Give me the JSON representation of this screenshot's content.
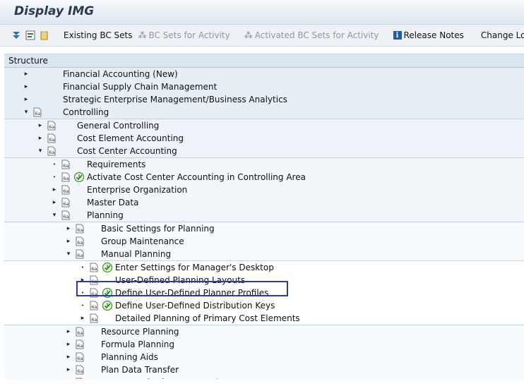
{
  "window": {
    "title": "Display IMG"
  },
  "toolbar": {
    "existing_bc_sets": "Existing BC Sets",
    "bc_sets_for_activity": "BC Sets for Activity",
    "activated_bc_sets": "Activated BC Sets for Activity",
    "release_notes": "Release Notes",
    "change_log": "Change Log"
  },
  "tree": {
    "header": "Structure",
    "rows": [
      {
        "label": "Financial Accounting (New)",
        "level": 0,
        "state": "collapsed",
        "doc": false,
        "exec": false,
        "group": 0
      },
      {
        "label": "Financial Supply Chain Management",
        "level": 0,
        "state": "collapsed",
        "doc": false,
        "exec": false,
        "group": 0
      },
      {
        "label": "Strategic Enterprise Management/Business Analytics",
        "level": 0,
        "state": "collapsed",
        "doc": false,
        "exec": false,
        "group": 0
      },
      {
        "label": "Controlling",
        "level": 0,
        "state": "expanded",
        "doc": true,
        "exec": false,
        "group": 0
      },
      {
        "label": "General Controlling",
        "level": 1,
        "state": "collapsed",
        "doc": true,
        "exec": false,
        "group": 1
      },
      {
        "label": "Cost Element Accounting",
        "level": 1,
        "state": "collapsed",
        "doc": true,
        "exec": false,
        "group": 1
      },
      {
        "label": "Cost Center Accounting",
        "level": 1,
        "state": "expanded",
        "doc": true,
        "exec": false,
        "group": 1
      },
      {
        "label": "Requirements",
        "level": 2,
        "state": "leaf",
        "doc": true,
        "exec": false,
        "group": 2
      },
      {
        "label": "Activate Cost Center Accounting in Controlling Area",
        "level": 2,
        "state": "leaf",
        "doc": true,
        "exec": true,
        "group": 2
      },
      {
        "label": "Enterprise Organization",
        "level": 2,
        "state": "collapsed",
        "doc": true,
        "exec": false,
        "group": 2
      },
      {
        "label": "Master Data",
        "level": 2,
        "state": "collapsed",
        "doc": true,
        "exec": false,
        "group": 2
      },
      {
        "label": "Planning",
        "level": 2,
        "state": "expanded",
        "doc": true,
        "exec": false,
        "group": 2
      },
      {
        "label": "Basic Settings for Planning",
        "level": 3,
        "state": "collapsed",
        "doc": true,
        "exec": false,
        "group": 3
      },
      {
        "label": "Group Maintenance",
        "level": 3,
        "state": "collapsed",
        "doc": true,
        "exec": false,
        "group": 3
      },
      {
        "label": "Manual Planning",
        "level": 3,
        "state": "expanded",
        "doc": true,
        "exec": false,
        "group": 3
      },
      {
        "label": "Enter Settings for Manager's Desktop",
        "level": 4,
        "state": "leaf",
        "doc": true,
        "exec": true,
        "group": 4
      },
      {
        "label": "User-Defined Planning Layouts",
        "level": 4,
        "state": "collapsed",
        "doc": true,
        "exec": false,
        "group": 4
      },
      {
        "label": "Define User-Defined Planner Profiles",
        "level": 4,
        "state": "leaf",
        "doc": true,
        "exec": true,
        "group": 4,
        "selected": true
      },
      {
        "label": "Define User-Defined Distribution Keys",
        "level": 4,
        "state": "leaf",
        "doc": true,
        "exec": true,
        "group": 4
      },
      {
        "label": "Detailed Planning of Primary Cost Elements",
        "level": 4,
        "state": "collapsed",
        "doc": true,
        "exec": false,
        "group": 4
      },
      {
        "label": "Resource Planning",
        "level": 3,
        "state": "collapsed",
        "doc": true,
        "exec": false,
        "group": 5
      },
      {
        "label": "Formula Planning",
        "level": 3,
        "state": "collapsed",
        "doc": true,
        "exec": false,
        "group": 5
      },
      {
        "label": "Planning Aids",
        "level": 3,
        "state": "collapsed",
        "doc": true,
        "exec": false,
        "group": 5
      },
      {
        "label": "Plan Data Transfer",
        "level": 3,
        "state": "collapsed",
        "doc": true,
        "exec": false,
        "group": 5
      },
      {
        "label": "Data Transfer from External Systems",
        "level": 3,
        "state": "leaf",
        "doc": true,
        "exec": false,
        "group": 5
      }
    ]
  },
  "icons": {
    "expanded": "triangle-down-icon",
    "collapsed": "triangle-right-icon",
    "leaf": "bullet-icon",
    "doc": "img-doc-icon",
    "exec": "execute-clock-icon"
  },
  "colors": {
    "highlight_border": "#2b3aa8",
    "execute_green": "#3b9a2e"
  }
}
